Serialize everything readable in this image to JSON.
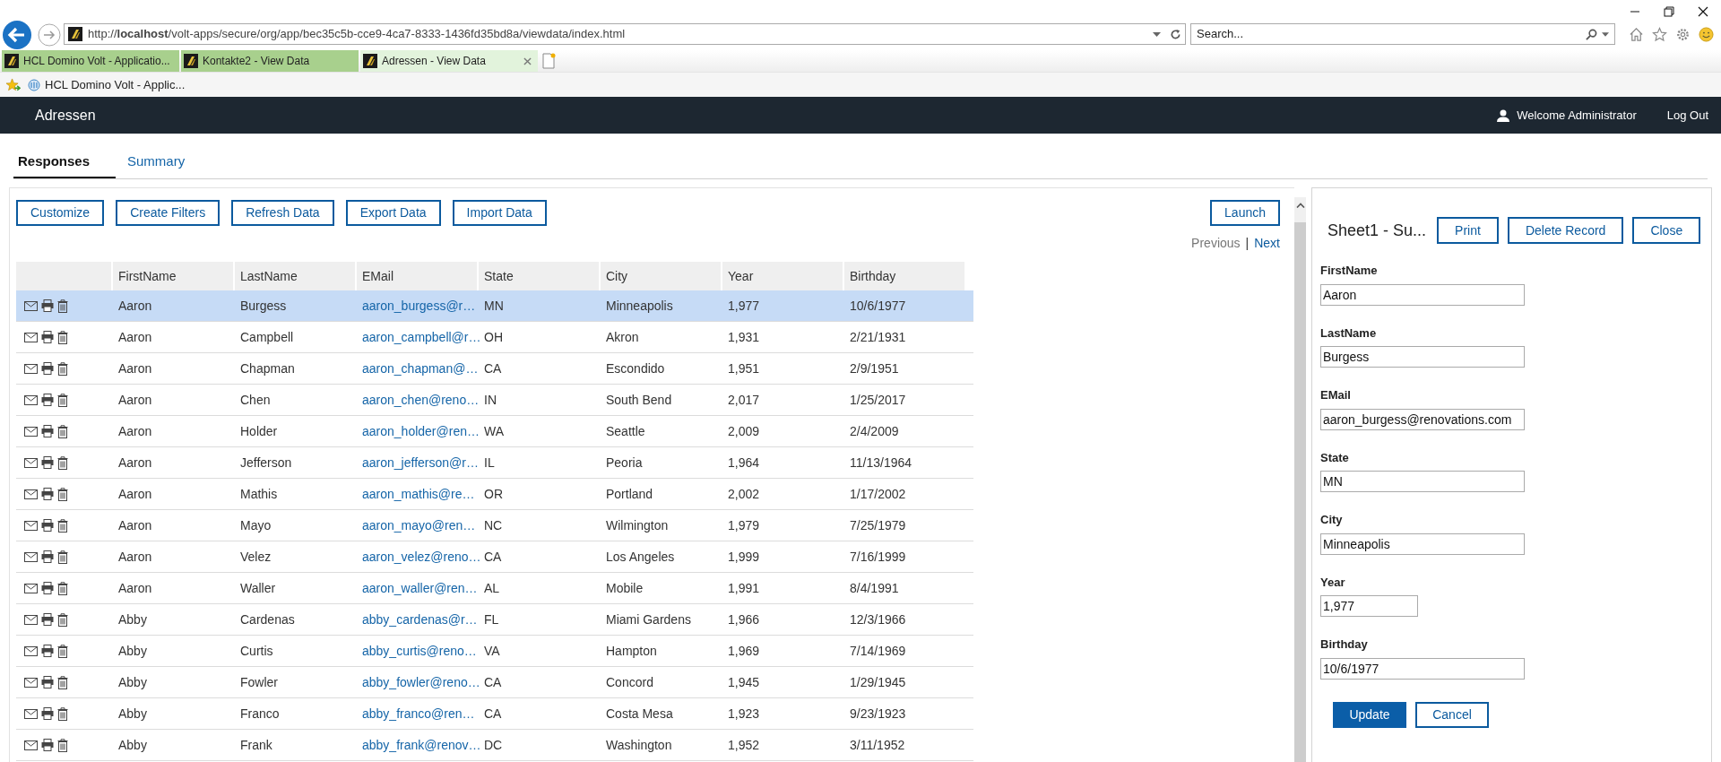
{
  "browser": {
    "url": "http://**localhost**/volt-apps/secure/org/app/bec35c5b-cce9-4ca7-8333-1436fd35bd8a/viewdata/index.html",
    "search": {
      "placeholder": "Search..."
    },
    "tabs": [
      {
        "label": "HCL Domino Volt - Applicatio...",
        "selected": false
      },
      {
        "label": "Kontakte2 - View Data",
        "selected": false
      },
      {
        "label": "Adressen - View Data",
        "selected": true
      }
    ],
    "favorites": [
      "HCL Domino Volt - Applic..."
    ]
  },
  "app": {
    "title": "Adressen",
    "user": "Welcome Administrator",
    "logout": "Log Out"
  },
  "view_tabs": [
    {
      "label": "Responses",
      "selected": true
    },
    {
      "label": "Summary",
      "selected": false
    }
  ],
  "toolbar": [
    "Customize",
    "Create Filters",
    "Refresh Data",
    "Export Data",
    "Import Data"
  ],
  "launch": "Launch",
  "pager": {
    "previous": {
      "label": "Previous",
      "disabled": true
    },
    "separator": "|",
    "next": {
      "label": "Next",
      "disabled": false
    }
  },
  "table": {
    "columns": [
      "FirstName",
      "LastName",
      "EMail",
      "State",
      "City",
      "Year",
      "Birthday"
    ],
    "rows": [
      {
        "selected": true,
        "cells": [
          "Aaron",
          "Burgess",
          "aaron_burgess@r…",
          "MN",
          "Minneapolis",
          "1,977",
          "10/6/1977"
        ]
      },
      {
        "selected": false,
        "cells": [
          "Aaron",
          "Campbell",
          "aaron_campbell@r…",
          "OH",
          "Akron",
          "1,931",
          "2/21/1931"
        ]
      },
      {
        "selected": false,
        "cells": [
          "Aaron",
          "Chapman",
          "aaron_chapman@…",
          "CA",
          "Escondido",
          "1,951",
          "2/9/1951"
        ]
      },
      {
        "selected": false,
        "cells": [
          "Aaron",
          "Chen",
          "aaron_chen@reno…",
          "IN",
          "South Bend",
          "2,017",
          "1/25/2017"
        ]
      },
      {
        "selected": false,
        "cells": [
          "Aaron",
          "Holder",
          "aaron_holder@ren…",
          "WA",
          "Seattle",
          "2,009",
          "2/4/2009"
        ]
      },
      {
        "selected": false,
        "cells": [
          "Aaron",
          "Jefferson",
          "aaron_jefferson@r…",
          "IL",
          "Peoria",
          "1,964",
          "11/13/1964"
        ]
      },
      {
        "selected": false,
        "cells": [
          "Aaron",
          "Mathis",
          "aaron_mathis@re…",
          "OR",
          "Portland",
          "2,002",
          "1/17/2002"
        ]
      },
      {
        "selected": false,
        "cells": [
          "Aaron",
          "Mayo",
          "aaron_mayo@ren…",
          "NC",
          "Wilmington",
          "1,979",
          "7/25/1979"
        ]
      },
      {
        "selected": false,
        "cells": [
          "Aaron",
          "Velez",
          "aaron_velez@reno…",
          "CA",
          "Los Angeles",
          "1,999",
          "7/16/1999"
        ]
      },
      {
        "selected": false,
        "cells": [
          "Aaron",
          "Waller",
          "aaron_waller@ren…",
          "AL",
          "Mobile",
          "1,991",
          "8/4/1991"
        ]
      },
      {
        "selected": false,
        "cells": [
          "Abby",
          "Cardenas",
          "abby_cardenas@r…",
          "FL",
          "Miami Gardens",
          "1,966",
          "12/3/1966"
        ]
      },
      {
        "selected": false,
        "cells": [
          "Abby",
          "Curtis",
          "abby_curtis@reno…",
          "VA",
          "Hampton",
          "1,969",
          "7/14/1969"
        ]
      },
      {
        "selected": false,
        "cells": [
          "Abby",
          "Fowler",
          "abby_fowler@reno…",
          "CA",
          "Concord",
          "1,945",
          "1/29/1945"
        ]
      },
      {
        "selected": false,
        "cells": [
          "Abby",
          "Franco",
          "abby_franco@ren…",
          "CA",
          "Costa Mesa",
          "1,923",
          "9/23/1923"
        ]
      },
      {
        "selected": false,
        "cells": [
          "Abby",
          "Frank",
          "abby_frank@renov…",
          "DC",
          "Washington",
          "1,952",
          "3/11/1952"
        ]
      }
    ]
  },
  "panel": {
    "title": "Sheet1 - Su...",
    "buttons": [
      "Print",
      "Delete Record",
      "Close"
    ],
    "fields": [
      {
        "label": "FirstName",
        "value": "Aaron",
        "kind": "wide"
      },
      {
        "label": "LastName",
        "value": "Burgess",
        "kind": "wide"
      },
      {
        "label": "EMail",
        "value": "aaron_burgess@renovations.com",
        "kind": "wide"
      },
      {
        "label": "State",
        "value": "MN",
        "kind": "wide"
      },
      {
        "label": "City",
        "value": "Minneapolis",
        "kind": "wide"
      },
      {
        "label": "Year",
        "value": "1,977",
        "kind": "narrow"
      },
      {
        "label": "Birthday",
        "value": "10/6/1977",
        "kind": "wide"
      }
    ],
    "actions": [
      {
        "label": "Update",
        "kind": "primary"
      },
      {
        "label": "Cancel",
        "kind": "secondary"
      }
    ]
  }
}
